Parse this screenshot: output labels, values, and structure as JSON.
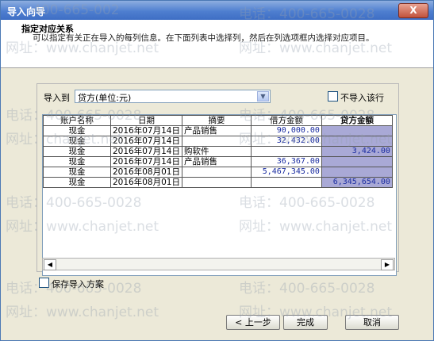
{
  "window": {
    "title": "导入向导",
    "close_label": "X"
  },
  "header": {
    "title": "指定对应关系",
    "description": "可以指定有关正在导入的每列信息。在下面列表中选择列，然后在列选项框内选择对应项目。"
  },
  "import_to": {
    "label": "导入到",
    "value": "贷方(单位:元)",
    "skip_label": "不导入该行"
  },
  "table": {
    "headers": [
      "账户名称",
      "日期",
      "摘要",
      "借方金额",
      "贷方金额"
    ],
    "rows": [
      [
        "现金",
        "2016年07月14日",
        "产品销售",
        "90,000.00",
        ""
      ],
      [
        "现金",
        "2016年07月14日",
        "",
        "32,432.00",
        ""
      ],
      [
        "现金",
        "2016年07月14日",
        "购软件",
        "",
        "3,424.00"
      ],
      [
        "现金",
        "2016年07月14日",
        "产品销售",
        "36,367.00",
        ""
      ],
      [
        "现金",
        "2016年08月01日",
        "",
        "5,467,345.00",
        ""
      ],
      [
        "现金",
        "2016年08月01日",
        "",
        "",
        "6,345,654.00"
      ]
    ]
  },
  "save_scheme": {
    "label": "保存导入方案"
  },
  "buttons": {
    "prev": "< 上一步",
    "finish": "完成",
    "cancel": "取消"
  },
  "watermarks": {
    "phone": "电话：400-665-0028",
    "site": "网址：www.chanjet.net",
    "phone_fragment": "400-665-002",
    "site_fragment": "网址：chanjet.net"
  }
}
